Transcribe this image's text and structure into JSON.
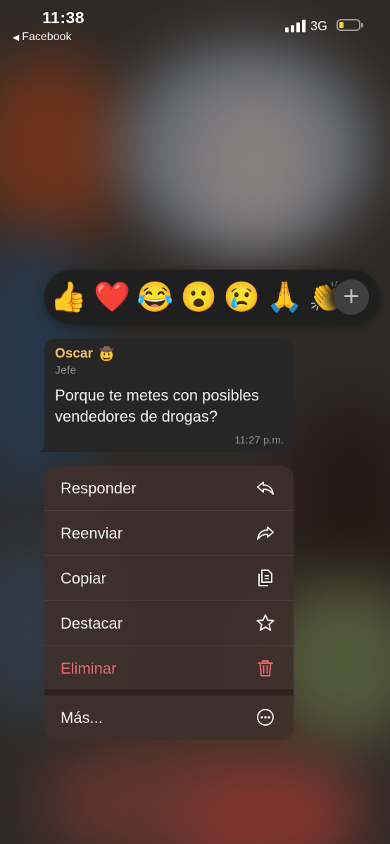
{
  "status_bar": {
    "time": "11:38",
    "back_app": "Facebook",
    "network": "3G"
  },
  "reactions": [
    {
      "emoji": "👍",
      "name": "thumbs-up"
    },
    {
      "emoji": "❤️",
      "name": "heart"
    },
    {
      "emoji": "😂",
      "name": "tears-of-joy"
    },
    {
      "emoji": "😮",
      "name": "surprised"
    },
    {
      "emoji": "😢",
      "name": "crying"
    },
    {
      "emoji": "🙏",
      "name": "folded-hands"
    },
    {
      "emoji": "👏",
      "name": "clapping"
    }
  ],
  "add_reaction_symbol": "+",
  "message": {
    "sender": "Oscar",
    "sender_emoji": "🤠",
    "role": "Jefe",
    "text": "Porque te metes con posibles vendedores de drogas?",
    "time": "11:27 p.m."
  },
  "menu": {
    "reply": "Responder",
    "forward": "Reenviar",
    "copy": "Copiar",
    "pin": "Destacar",
    "delete": "Eliminar",
    "more": "Más..."
  },
  "colors": {
    "sender_name": "#f3c063",
    "delete": "#e9676f",
    "bubble": "#262626",
    "reaction_bar": "#1f1f1f"
  }
}
